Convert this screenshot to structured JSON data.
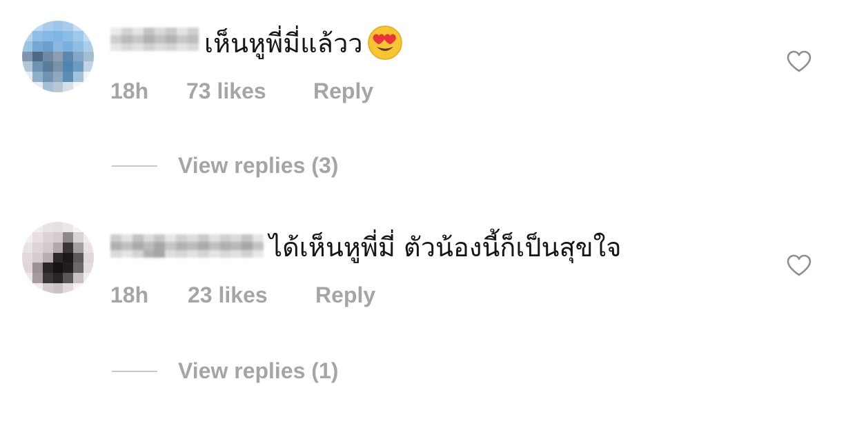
{
  "comments": [
    {
      "text": "เห็นหูพี่มี่แล้วว",
      "emoji": "smiling-face-with-heart-eyes",
      "time": "18h",
      "likes": "73 likes",
      "reply_label": "Reply",
      "view_replies": "View replies (3)"
    },
    {
      "text": "ได้เห็นหูพี่มี่ ตัวน้องนี้ก็เป็นสุขใจ",
      "time": "18h",
      "likes": "23 likes",
      "reply_label": "Reply",
      "view_replies": "View replies (1)"
    }
  ],
  "colors": {
    "meta_text": "#a5a5a5",
    "comment_text": "#161616",
    "divider": "#c7c7c7",
    "heart_outline": "#8e8e8e"
  }
}
